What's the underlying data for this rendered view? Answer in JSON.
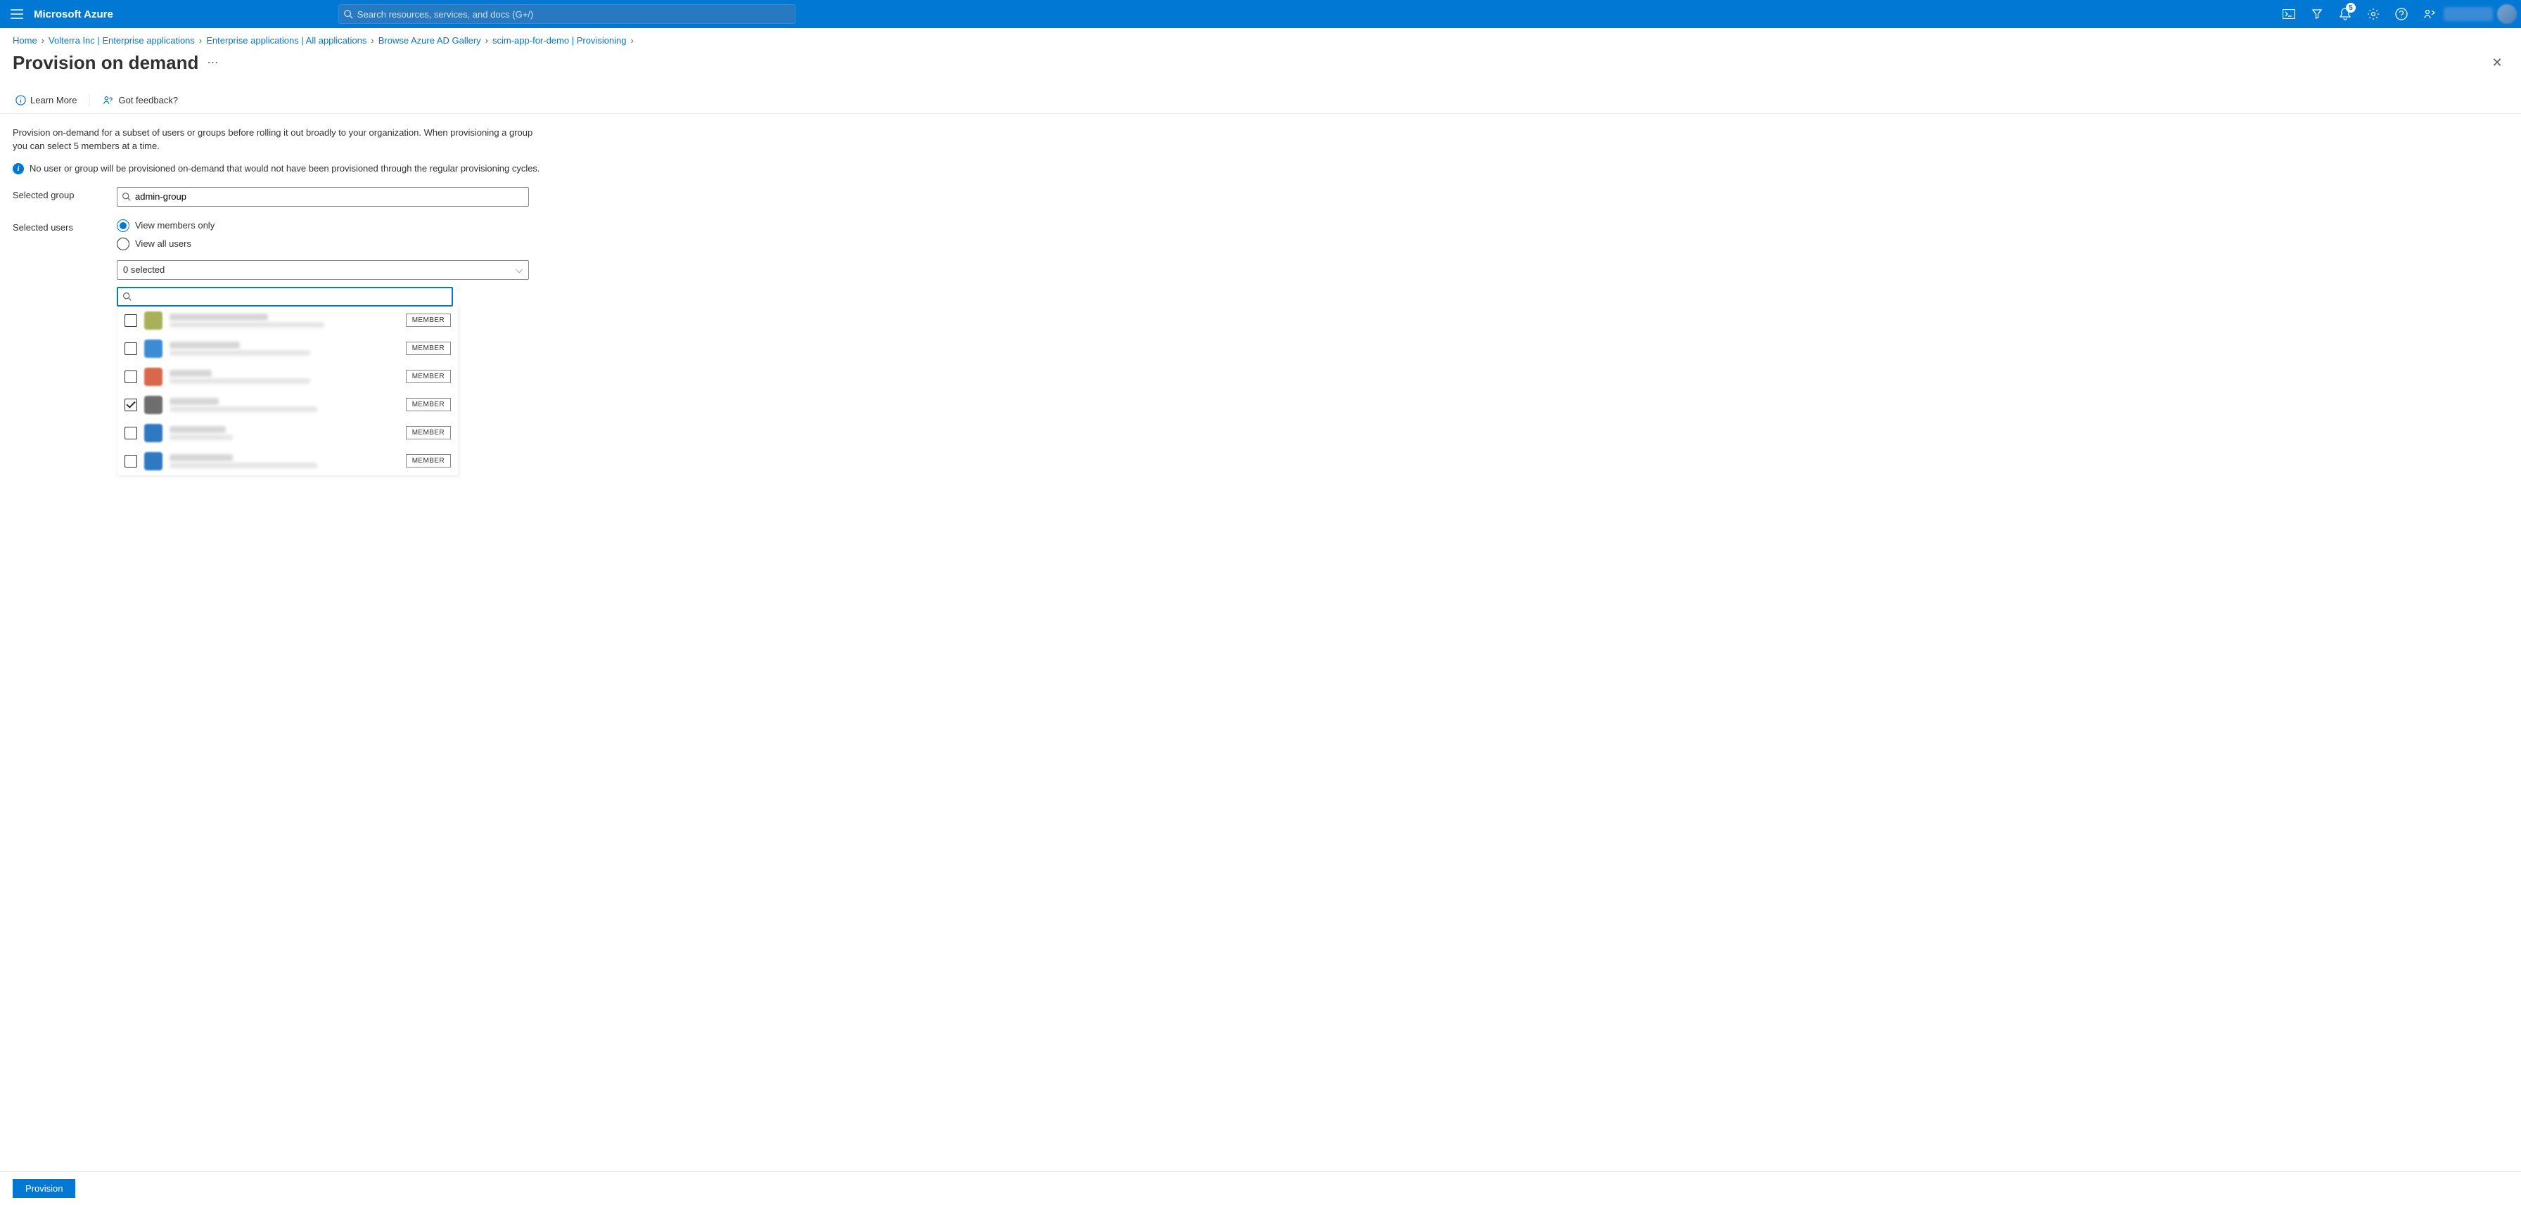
{
  "brand": "Microsoft Azure",
  "search_placeholder": "Search resources, services, and docs (G+/)",
  "notification_count": "5",
  "breadcrumb": [
    "Home",
    "Volterra Inc | Enterprise applications",
    "Enterprise applications | All applications",
    "Browse Azure AD Gallery",
    "scim-app-for-demo | Provisioning"
  ],
  "page_title": "Provision on demand",
  "cmd": {
    "learn_more": "Learn More",
    "got_feedback": "Got feedback?"
  },
  "intro_text": "Provision on-demand for a subset of users or groups before rolling it out broadly to your organization. When provisioning a group you can select 5 members at a time.",
  "info_text": "No user or group will be provisioned on-demand that would not have been provisioned through the regular provisioning cycles.",
  "labels": {
    "selected_group": "Selected group",
    "selected_users": "Selected users"
  },
  "group_value": "admin-group",
  "radios": {
    "members_only": "View members only",
    "all_users": "View all users"
  },
  "dropdown_text": "0 selected",
  "filter_placeholder": "",
  "member_badge_label": "MEMBER",
  "members": [
    {
      "checked": false,
      "avatar_color": "#a8b159",
      "w1": 140,
      "w2": 220
    },
    {
      "checked": false,
      "avatar_color": "#3d8bd4",
      "w1": 100,
      "w2": 200
    },
    {
      "checked": false,
      "avatar_color": "#d9674b",
      "w1": 60,
      "w2": 200
    },
    {
      "checked": true,
      "avatar_color": "#6e6e6e",
      "w1": 70,
      "w2": 210
    },
    {
      "checked": false,
      "avatar_color": "#2f78c2",
      "w1": 80,
      "w2": 90
    },
    {
      "checked": false,
      "avatar_color": "#2f78c2",
      "w1": 90,
      "w2": 210
    }
  ],
  "provision_btn": "Provision"
}
